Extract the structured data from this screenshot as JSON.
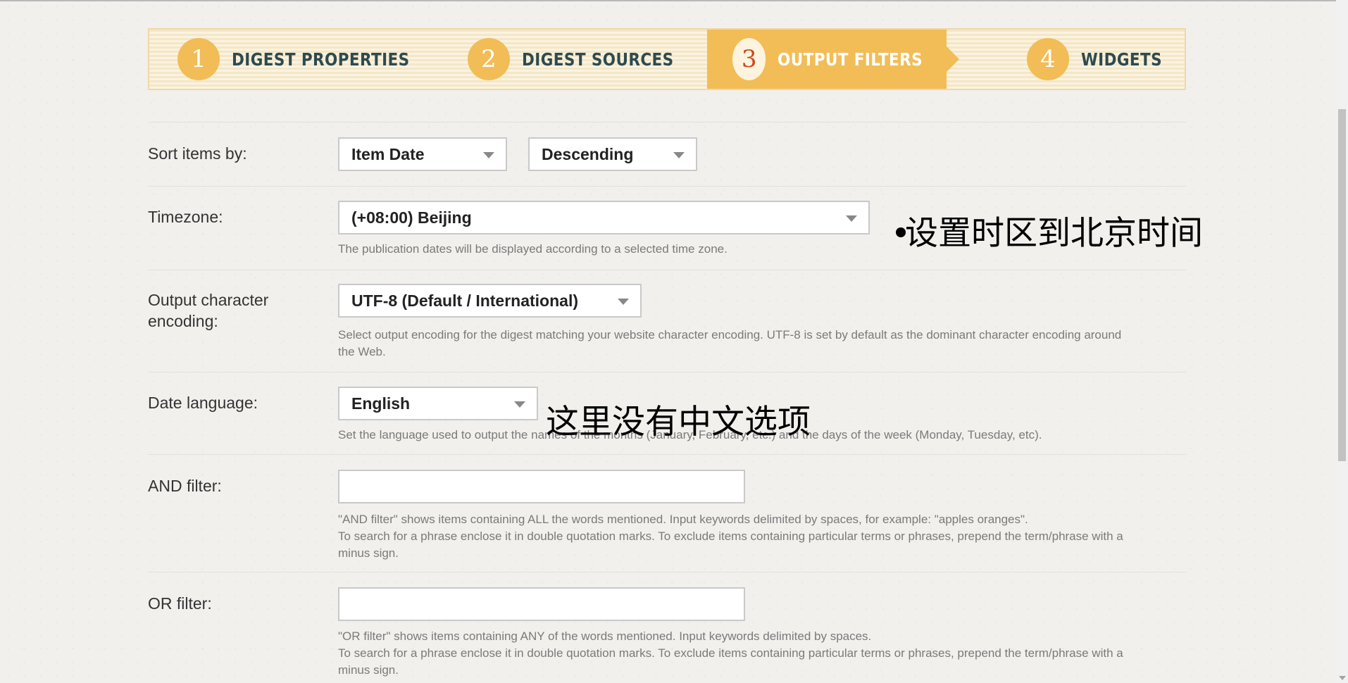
{
  "steps": [
    {
      "num": "1",
      "label": "DIGEST PROPERTIES"
    },
    {
      "num": "2",
      "label": "DIGEST SOURCES"
    },
    {
      "num": "3",
      "label": "OUTPUT FILTERS",
      "active": true
    },
    {
      "num": "4",
      "label": "WIDGETS"
    }
  ],
  "sort": {
    "label": "Sort items by:",
    "field_value": "Item Date",
    "order_value": "Descending"
  },
  "timezone": {
    "label": "Timezone:",
    "value": "(+08:00) Beijing",
    "help": "The publication dates will be displayed according to a selected time zone.",
    "annotation": "设置时区到北京时间"
  },
  "encoding": {
    "label_line1": "Output character",
    "label_line2": "encoding:",
    "value": "UTF-8 (Default / International)",
    "help_line1": "Select output encoding for the digest matching your website character encoding. UTF-8 is set by default as the dominant character encoding around",
    "help_line2": "the Web."
  },
  "date_language": {
    "label": "Date language:",
    "value": "English",
    "help": "Set the language used to output the names of the months (January, February, etc.) and the days of the week (Monday, Tuesday, etc).",
    "annotation": "这里没有中文选项"
  },
  "and_filter": {
    "label": "AND filter:",
    "value": "",
    "help_line1": "\"AND filter\" shows items containing ALL the words mentioned. Input keywords delimited by spaces, for example: \"apples oranges\".",
    "help_line2": "To search for a phrase enclose it in double quotation marks. To exclude items containing particular terms or phrases, prepend the term/phrase with a",
    "help_line3": "minus sign."
  },
  "or_filter": {
    "label": "OR filter:",
    "value": "",
    "help_line1": "\"OR filter\" shows items containing ANY of the words mentioned. Input keywords delimited by spaces.",
    "help_line2": "To search for a phrase enclose it in double quotation marks. To exclude items containing particular terms or phrases, prepend the term/phrase with a",
    "help_line3": "minus sign."
  },
  "colors": {
    "accent": "#f2bd56",
    "step_text": "#2e4a50",
    "active_number": "#c9491c"
  }
}
